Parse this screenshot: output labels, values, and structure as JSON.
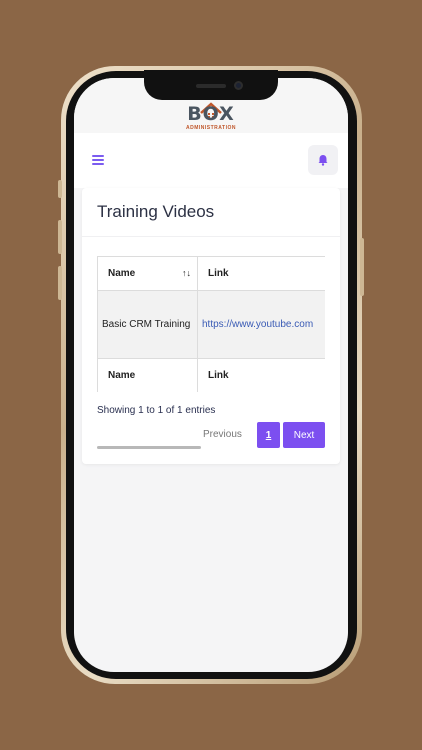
{
  "logo": {
    "text": "BOX",
    "subtitle": "ADMINISTRATION"
  },
  "header": {
    "menu_icon": "hamburger-icon",
    "bell_icon": "bell-icon"
  },
  "page": {
    "title": "Training Videos"
  },
  "table": {
    "columns": [
      "Name",
      "Link"
    ],
    "rows": [
      {
        "name": "Basic CRM Training",
        "link": "https://www.youtube.com"
      }
    ],
    "footer": [
      "Name",
      "Link"
    ],
    "sort_icon": "↑↓"
  },
  "info": "Showing 1 to 1 of 1 entries",
  "pagination": {
    "previous": "Previous",
    "current": "1",
    "next": "Next"
  },
  "colors": {
    "accent": "#7c4ff0",
    "background": "#8b6646"
  }
}
